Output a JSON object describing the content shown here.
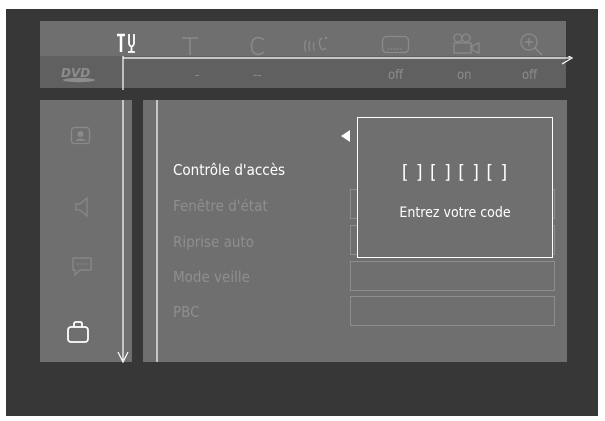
{
  "top_icons": [
    {
      "name": "preferences-icon",
      "active": true
    },
    {
      "name": "title-icon",
      "active": false
    },
    {
      "name": "chapter-icon",
      "active": false
    },
    {
      "name": "audio-language-icon",
      "active": false
    },
    {
      "name": "subtitle-icon",
      "active": false
    },
    {
      "name": "angle-icon",
      "active": false
    },
    {
      "name": "zoom-icon",
      "active": false
    }
  ],
  "status": {
    "disc_logo": "DVD",
    "title": "-",
    "chapter": "--",
    "audio": "off",
    "subtitle": "on",
    "angle": "off"
  },
  "sidebar_icons": [
    "picture-icon",
    "sound-icon",
    "language-icon",
    "features-icon"
  ],
  "menu": {
    "items": [
      "Contrôle d'accès",
      "Fenêtre d'état",
      "Riprise auto",
      "Mode veille",
      "PBC"
    ],
    "selected_index": 0
  },
  "popup": {
    "code": "[ ] [ ] [ ] [ ]",
    "prompt": "Entrez votre code"
  }
}
